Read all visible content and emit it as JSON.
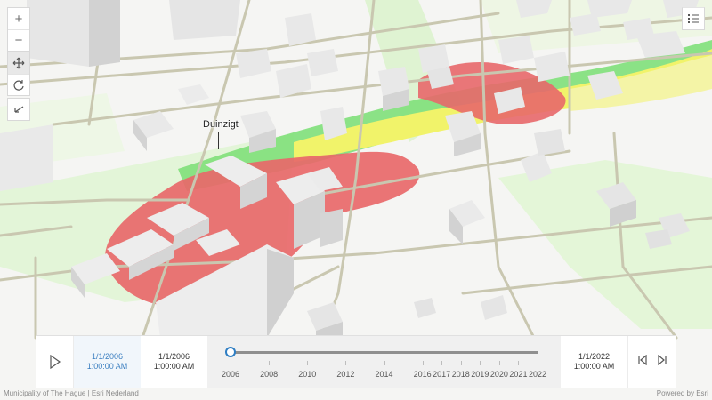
{
  "map": {
    "place_label": "Duinzigt"
  },
  "controls": {
    "zoom_in": "+",
    "zoom_out": "−",
    "pan_icon": "pan-icon",
    "rotate_icon": "rotate-icon",
    "back_icon": "arrow-back-icon",
    "legend_icon": "legend-list-icon"
  },
  "time_slider": {
    "current_start_date": "1/1/2006",
    "current_start_time": "1:00:00 AM",
    "min_date": "1/1/2006",
    "min_time": "1:00:00 AM",
    "max_date": "1/1/2022",
    "max_time": "1:00:00 AM",
    "position_fraction": 0,
    "ticks": [
      "2006",
      "2008",
      "2010",
      "2012",
      "2014",
      "2016",
      "2017",
      "2018",
      "2019",
      "2020",
      "2021",
      "2022"
    ]
  },
  "footer": {
    "attribution": "Municipality of The Hague | Esri Nederland",
    "powered_by": "Powered by Esri"
  },
  "colors": {
    "high": "#e8686a",
    "medium": "#eef06a",
    "low": "#7fe07a",
    "accent": "#2f7ec3"
  }
}
